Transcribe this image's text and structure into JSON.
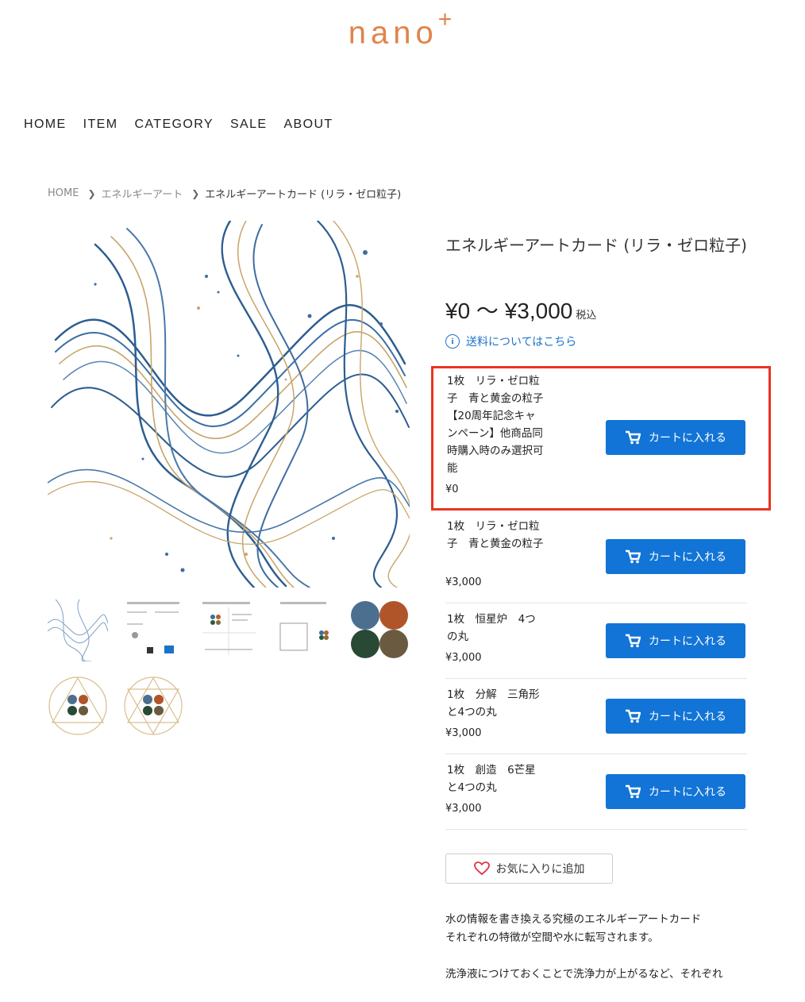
{
  "brand": {
    "name": "nano",
    "mark": "+"
  },
  "nav": [
    "HOME",
    "ITEM",
    "CATEGORY",
    "SALE",
    "ABOUT"
  ],
  "breadcrumb": [
    "HOME",
    "エネルギーアート",
    "エネルギーアートカード (リラ・ゼロ粒子)"
  ],
  "product": {
    "title": "エネルギーアートカード (リラ・ゼロ粒子)",
    "price": "¥0 〜 ¥3,000",
    "tax_label": "税込",
    "shipping_link": "送料についてはこちら",
    "cart_label": "カートに入れる",
    "favorite_label": "お気に入りに追加"
  },
  "variants": [
    {
      "name": "1枚　リラ・ゼロ粒子　青と黄金の粒子【20周年記念キャンペーン】他商品同時購入時のみ選択可能",
      "price": "¥0"
    },
    {
      "name": "1枚　リラ・ゼロ粒子　青と黄金の粒子",
      "price": "¥3,000"
    },
    {
      "name": "1枚　恒星炉　4つの丸",
      "price": "¥3,000"
    },
    {
      "name": "1枚　分解　三角形と4つの丸",
      "price": "¥3,000"
    },
    {
      "name": "1枚　創造　6芒星と4つの丸",
      "price": "¥3,000"
    }
  ],
  "description": [
    "水の情報を書き換える究極のエネルギーアートカード",
    "それぞれの特徴が空間や水に転写されます。",
    "洗浄液につけておくことで洗浄力が上がるなど、それぞれ"
  ],
  "colors": {
    "accent": "#1274d6",
    "brand": "#e0844c",
    "highlight": "#ea3323"
  },
  "icons": [
    "cart-icon",
    "info-icon",
    "heart-icon",
    "chevron-right-icon"
  ]
}
